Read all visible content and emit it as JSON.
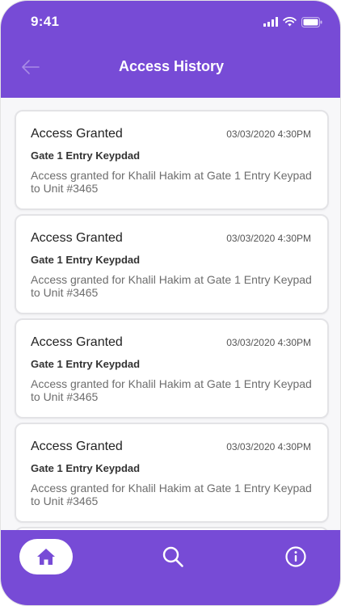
{
  "status_bar": {
    "time": "9:41"
  },
  "header": {
    "title": "Access History"
  },
  "entries": [
    {
      "title": "Access Granted",
      "time": "03/03/2020 4:30PM",
      "location": "Gate 1 Entry Keypdad",
      "description": "Access granted for Khalil Hakim at Gate 1 Entry Keypad to Unit #3465"
    },
    {
      "title": "Access Granted",
      "time": "03/03/2020 4:30PM",
      "location": "Gate 1 Entry Keypdad",
      "description": "Access granted for Khalil Hakim at Gate 1 Entry Keypad to Unit #3465"
    },
    {
      "title": "Access Granted",
      "time": "03/03/2020 4:30PM",
      "location": "Gate 1 Entry Keypdad",
      "description": "Access granted for Khalil Hakim at Gate 1 Entry Keypad to Unit #3465"
    },
    {
      "title": "Access Granted",
      "time": "03/03/2020 4:30PM",
      "location": "Gate 1 Entry Keypdad",
      "description": "Access granted for Khalil Hakim at Gate 1 Entry Keypad to Unit #3465"
    }
  ],
  "nav": {
    "items": [
      {
        "icon": "home-icon",
        "active": true
      },
      {
        "icon": "search-icon",
        "active": false
      },
      {
        "icon": "info-icon",
        "active": false
      }
    ]
  },
  "colors": {
    "accent": "#774bd6",
    "card_border": "#e3e3e6",
    "text_primary": "#222222",
    "text_secondary": "#6d6d6d"
  }
}
